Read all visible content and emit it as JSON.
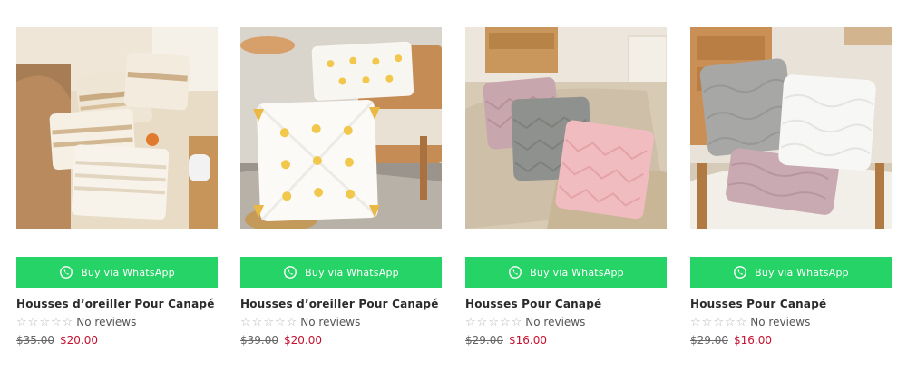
{
  "colors": {
    "whatsapp_green": "#25d366",
    "sale_price": "#c8102e",
    "star_empty": "#b8b8b8"
  },
  "products": [
    {
      "image_icon": "cream-tassel-pillows-photo",
      "button_label": "Buy via WhatsApp",
      "title": "Housses d’oreiller Pour Canapé",
      "rating_stars": 0,
      "reviews_label": "No reviews",
      "old_price": "$35.00",
      "new_price": "$20.00"
    },
    {
      "image_icon": "white-yellow-pompom-pillows-photo",
      "button_label": "Buy via WhatsApp",
      "title": "Housses d’oreiller Pour Canapé",
      "rating_stars": 0,
      "reviews_label": "No reviews",
      "old_price": "$39.00",
      "new_price": "$20.00"
    },
    {
      "image_icon": "pink-gray-chevron-pillows-photo",
      "button_label": "Buy via WhatsApp",
      "title": "Housses Pour Canapé",
      "rating_stars": 0,
      "reviews_label": "No reviews",
      "old_price": "$29.00",
      "new_price": "$16.00"
    },
    {
      "image_icon": "gray-white-plush-pillows-photo",
      "button_label": "Buy via WhatsApp",
      "title": "Housses Pour Canapé",
      "rating_stars": 0,
      "reviews_label": "No reviews",
      "old_price": "$29.00",
      "new_price": "$16.00"
    }
  ]
}
